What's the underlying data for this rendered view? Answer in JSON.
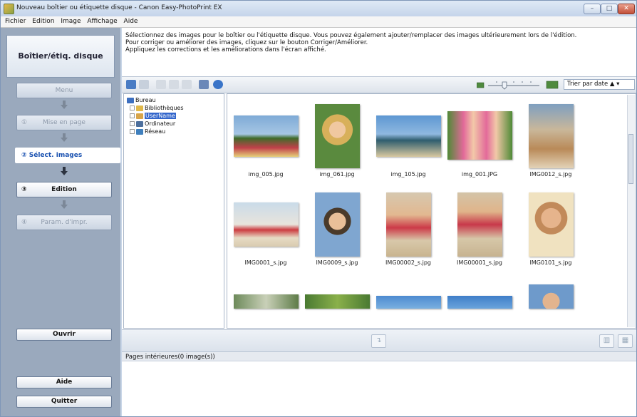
{
  "window": {
    "title": "Nouveau boîtier ou étiquette disque - Canon Easy-PhotoPrint EX",
    "controls": [
      "–",
      "□",
      "✕"
    ]
  },
  "menubar": [
    "Fichier",
    "Edition",
    "Image",
    "Affichage",
    "Aide"
  ],
  "sidebar": {
    "heading": "Boîtier/étiq. disque",
    "steps": {
      "menu": "Menu",
      "layout_num": "①",
      "layout": "Mise en page",
      "select_num": "②",
      "select": "Sélect. images",
      "edit_num": "③",
      "edit": "Edition",
      "print_num": "④",
      "print": "Param. d'impr."
    },
    "open": "Ouvrir",
    "help": "Aide",
    "quit": "Quitter"
  },
  "instructions": [
    "Sélectionnez des images pour le boîtier ou l'étiquette disque. Vous pouvez également ajouter/remplacer des images ultérieurement lors de l'édition.",
    "Pour corriger ou améliorer des images, cliquez sur le bouton Corriger/Améliorer.",
    "Appliquez les corrections et les améliorations dans l'écran affiché."
  ],
  "toolbar": {
    "sort_label": "Trier par date",
    "sort_arrow": "▲ ▾"
  },
  "tree": {
    "root": "Bureau",
    "items": [
      "Bibliothèques",
      "UserName",
      "Ordinateur",
      "Réseau"
    ]
  },
  "gallery": {
    "images": [
      "img_005.jpg",
      "img_061.jpg",
      "img_105.jpg",
      "img_001.JPG",
      "IMG0012_s.jpg",
      "IMG0001_s.jpg",
      "IMG0009_s.jpg",
      "IMG00002_s.jpg",
      "IMG00001_s.jpg",
      "IMG0101_s.jpg"
    ]
  },
  "pages": {
    "header": "Pages intérieures(0 image(s))"
  },
  "colors": {
    "sidebar_bg": "#9aa9bd",
    "active_step_text": "#1850b0",
    "selection": "#3366cc"
  }
}
